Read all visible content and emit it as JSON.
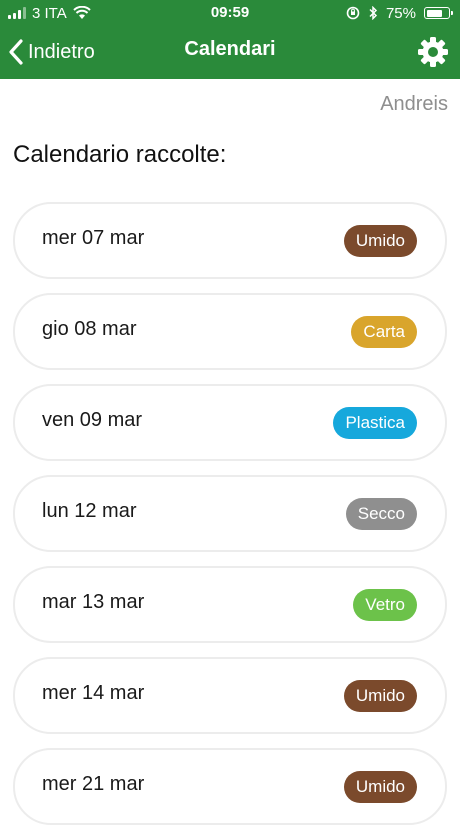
{
  "status_bar": {
    "carrier": "3 ITA",
    "time": "09:59",
    "battery": "75%",
    "battery_level": 0.75
  },
  "nav": {
    "back_label": "Indietro",
    "title": "Calendari",
    "settings_icon": "gear-icon",
    "color": "#2a8a3a"
  },
  "user": {
    "name": "Andreis"
  },
  "calendar": {
    "title": "Calendario raccolte:",
    "entries": [
      {
        "date": "mer 07 mar",
        "type": "Umido",
        "color": "#7b4a2c"
      },
      {
        "date": "gio 08 mar",
        "type": "Carta",
        "color": "#d9a52c"
      },
      {
        "date": "ven 09 mar",
        "type": "Plastica",
        "color": "#16a8dc"
      },
      {
        "date": "lun 12 mar",
        "type": "Secco",
        "color": "#8f8f8f"
      },
      {
        "date": "mar 13 mar",
        "type": "Vetro",
        "color": "#6cc24a"
      },
      {
        "date": "mer 14 mar",
        "type": "Umido",
        "color": "#7b4a2c"
      },
      {
        "date": "mer 21 mar",
        "type": "Umido",
        "color": "#7b4a2c"
      }
    ]
  }
}
